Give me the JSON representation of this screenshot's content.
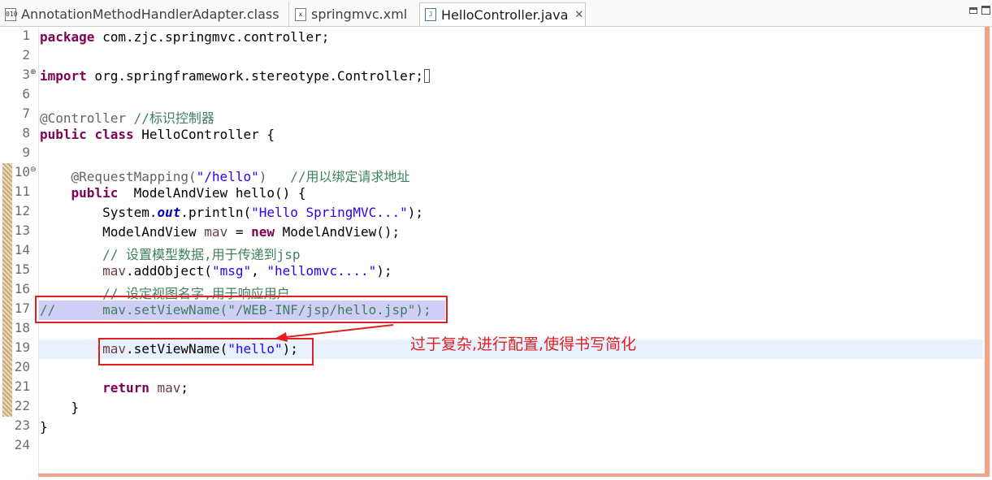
{
  "tabs": [
    {
      "label": "AnnotationMethodHandlerAdapter.class",
      "icon": "class-file-icon"
    },
    {
      "label": "springmvc.xml",
      "icon": "xml-file-icon"
    },
    {
      "label": "HelloController.java",
      "icon": "java-file-icon",
      "active": true,
      "close": "✕"
    }
  ],
  "window_controls": [
    "minimize",
    "maximize"
  ],
  "editor": {
    "line_numbers": [
      "1",
      "2",
      "3",
      "6",
      "7",
      "8",
      "9",
      "10",
      "11",
      "12",
      "13",
      "14",
      "15",
      "16",
      "17",
      "18",
      "19",
      "20",
      "21",
      "22",
      "23",
      "24"
    ],
    "lines": [
      {
        "n": "1",
        "segs": [
          [
            "kw",
            "package"
          ],
          [
            "",
            "  com.zjc.springmvc.controller;"
          ]
        ]
      },
      {
        "n": "2",
        "segs": []
      },
      {
        "n": "3",
        "fold": "⊕",
        "segs": [
          [
            "kw",
            "import"
          ],
          [
            "",
            ""
          ]
        ]
      },
      {
        "n": "6",
        "segs": []
      },
      {
        "n": "7",
        "segs": []
      },
      {
        "n": "8",
        "segs": []
      },
      {
        "n": "9",
        "segs": []
      },
      {
        "n": "10",
        "fold": "⊖",
        "segs": []
      },
      {
        "n": "11",
        "segs": []
      },
      {
        "n": "12",
        "segs": []
      },
      {
        "n": "13",
        "segs": []
      },
      {
        "n": "14",
        "segs": []
      },
      {
        "n": "15",
        "segs": []
      },
      {
        "n": "16",
        "segs": []
      },
      {
        "n": "17",
        "segs": []
      },
      {
        "n": "18",
        "segs": []
      },
      {
        "n": "19",
        "segs": []
      },
      {
        "n": "20",
        "segs": []
      },
      {
        "n": "21",
        "segs": []
      },
      {
        "n": "22",
        "segs": []
      },
      {
        "n": "23",
        "segs": []
      },
      {
        "n": "24",
        "segs": []
      }
    ],
    "code": {
      "l1_kw": "package",
      "l1_rest": " com.zjc.springmvc.controller;",
      "l3_kw": "import",
      "l3_rest": " org.springframework.stereotype.Controller;",
      "l7_ann": "@Controller",
      "l7_cm": " //标识控制器",
      "l8_kw1": "public",
      "l8_kw2": "class",
      "l8_rest": " HelloController {",
      "l10_ann": "@RequestMapping(",
      "l10_str": "\"/hello\"",
      "l10_close": ")",
      "l10_cm": "   //用以绑定请求地址",
      "l11_kw": "public",
      "l11_rest": "  ModelAndView hello() {",
      "l12_a": "System.",
      "l12_fld": "out",
      "l12_b": ".println(",
      "l12_str": "\"Hello SpringMVC...\"",
      "l12_c": ");",
      "l13_a": "ModelAndView ",
      "l13_var": "mav",
      "l13_b": " = ",
      "l13_kw": "new",
      "l13_c": " ModelAndView();",
      "l14_cm": "// 设置模型数据,用于传递到jsp",
      "l15_var": "mav",
      "l15_a": ".addObject(",
      "l15_str1": "\"msg\"",
      "l15_b": ", ",
      "l15_str2": "\"hellomvc....\"",
      "l15_c": ");",
      "l16_cm": "// 设定视图名字,用于响应用户",
      "l17_cm": "//      mav.setViewName(\"/WEB-INF/jsp/hello.jsp\");",
      "l19_var": "mav",
      "l19_a": ".setViewName(",
      "l19_str": "\"hello\"",
      "l19_b": ");",
      "l21_kw": "return",
      "l21_var": " mav",
      "l21_rest": ";",
      "l22": "}",
      "l23": "}"
    }
  },
  "annotation_note": "过于复杂,进行配置,使得书写简化",
  "colors": {
    "accent_red": "#e02020",
    "keyword": "#7f0055",
    "comment": "#3f7f5f",
    "string": "#2a00ff",
    "margin_orange": "#f3a383"
  }
}
